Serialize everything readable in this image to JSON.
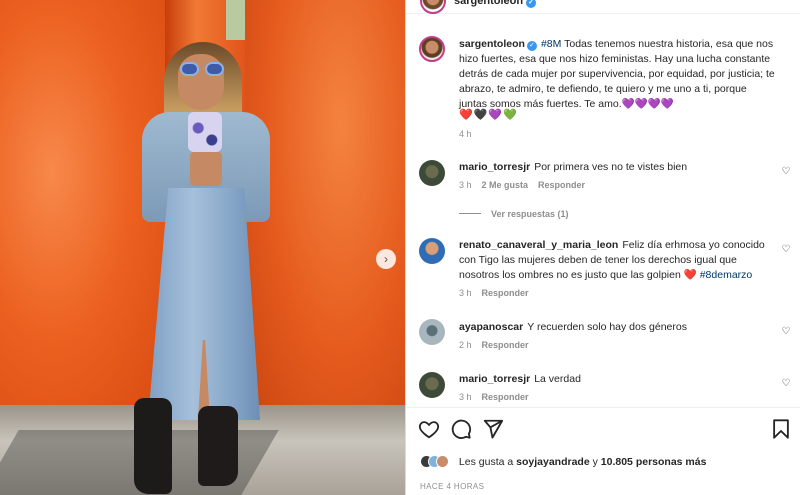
{
  "post": {
    "username": "sargentoleon",
    "caption_hashtag": "#8M",
    "caption_text": "Todas tenemos nuestra historia, esa que nos hizo fuertes, esa que nos hizo feministas. Hay una lucha constante detrás de cada mujer por supervivencia, por equidad, por justicia; te abrazo, te admiro, te defiendo, te quiero y me uno a ti, porque juntas somos más fuertes. Te amo.💜💜💜💜",
    "caption_hearts": "❤️🖤💜💚",
    "caption_age": "4 h",
    "next_arrow": "›"
  },
  "comments": [
    {
      "username": "mario_torresjr",
      "text": "Por primera ves no te vistes bien",
      "age": "3 h",
      "likes": "2 Me gusta",
      "reply": "Responder",
      "view_replies": "Ver respuestas (1)"
    },
    {
      "username": "renato_canaveral_y_maria_leon",
      "text": "Feliz día erhmosa yo conocido con Tigo las mujeres deben de tener los derechos igual que nosotros los ombres no es justo que las golpien ❤️",
      "hashtag": "#8demarzo",
      "age": "3 h",
      "reply": "Responder"
    },
    {
      "username": "ayapanoscar",
      "text": "Y recuerden solo hay dos géneros",
      "age": "2 h",
      "reply": "Responder"
    },
    {
      "username": "mario_torresjr",
      "text": "La verdad",
      "age": "3 h",
      "reply": "Responder"
    }
  ],
  "actions": {
    "likes_prefix": "Les gusta a",
    "likes_user": "soyjayandrade",
    "likes_joiner": "y",
    "likes_count": "10.805 personas más",
    "timestamp": "Hace 4 horas"
  },
  "icons": [
    "heart-icon",
    "comment-icon",
    "share-icon",
    "bookmark-icon",
    "verified-icon",
    "next-arrow-icon"
  ],
  "colors": {
    "verified": "#3897f0",
    "hashtag": "#00376b",
    "muted": "#8e8e8e",
    "wall": "#e8571f"
  }
}
